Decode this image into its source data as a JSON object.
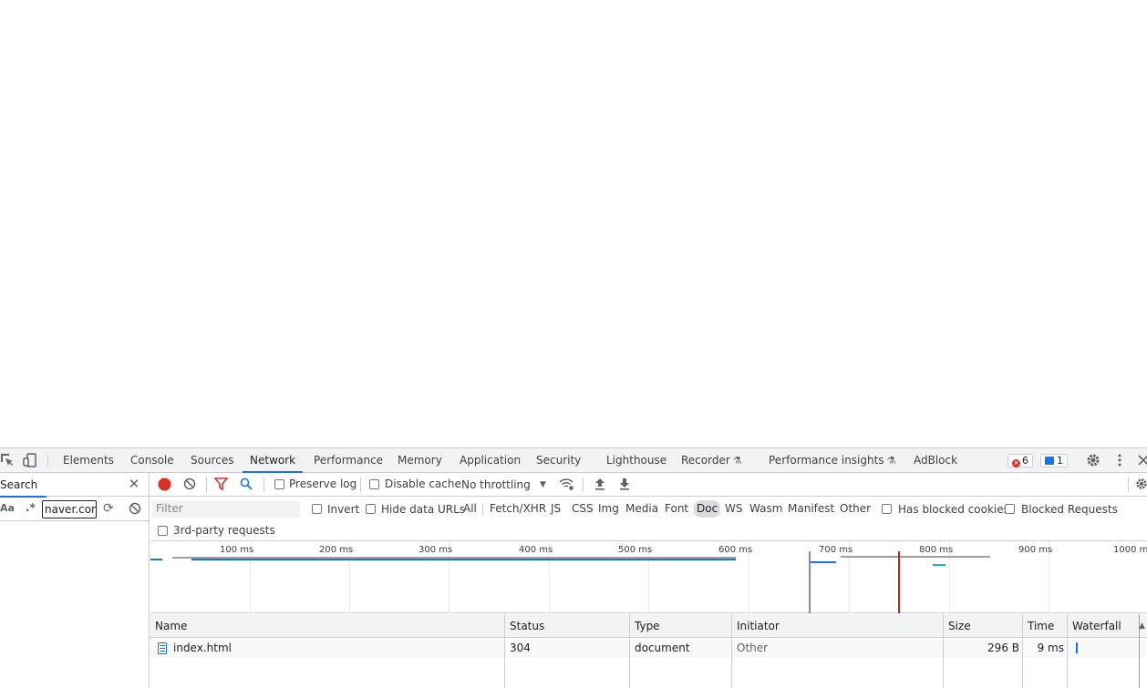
{
  "devtools": {
    "tabs": [
      {
        "label": "Elements"
      },
      {
        "label": "Console"
      },
      {
        "label": "Sources"
      },
      {
        "label": "Network",
        "active": true
      },
      {
        "label": "Performance"
      },
      {
        "label": "Memory"
      },
      {
        "label": "Application"
      },
      {
        "label": "Security"
      },
      {
        "label": "Lighthouse"
      },
      {
        "label": "Recorder",
        "experimental": true
      },
      {
        "label": "Performance insights",
        "experimental": true
      },
      {
        "label": "AdBlock"
      }
    ],
    "error_count": "6",
    "message_count": "1"
  },
  "search_panel": {
    "title": "Search",
    "case_toggle": "Aa",
    "regex_toggle": ".*",
    "query": "naver.com"
  },
  "network": {
    "recording": true,
    "preserve_log": {
      "label": "Preserve log",
      "checked": false
    },
    "disable_cache": {
      "label": "Disable cache",
      "checked": false
    },
    "throttling": "No throttling",
    "filter_placeholder": "Filter",
    "invert": {
      "label": "Invert",
      "checked": false
    },
    "hide_data_urls": {
      "label": "Hide data URLs",
      "checked": false
    },
    "type_filters": [
      "All",
      "Fetch/XHR",
      "JS",
      "CSS",
      "Img",
      "Media",
      "Font",
      "Doc",
      "WS",
      "Wasm",
      "Manifest",
      "Other"
    ],
    "active_type_filter": "Doc",
    "has_blocked_cookies": {
      "label": "Has blocked cookies",
      "checked": false
    },
    "blocked_requests": {
      "label": "Blocked Requests",
      "checked": false
    },
    "third_party": {
      "label": "3rd-party requests",
      "checked": false
    },
    "overview_ticks": [
      "100 ms",
      "200 ms",
      "300 ms",
      "400 ms",
      "500 ms",
      "600 ms",
      "700 ms",
      "800 ms",
      "900 ms",
      "1000 ms"
    ],
    "columns": [
      "Name",
      "Status",
      "Type",
      "Initiator",
      "Size",
      "Time",
      "Waterfall"
    ],
    "rows": [
      {
        "name": "index.html",
        "status": "304",
        "type": "document",
        "initiator": "Other",
        "size": "296 B",
        "time": "9 ms"
      }
    ],
    "colors": {
      "accent": "#1a73e8",
      "record": "#d93025",
      "load_line": "#c5221f",
      "dcl_line": "#7b84e3"
    }
  }
}
